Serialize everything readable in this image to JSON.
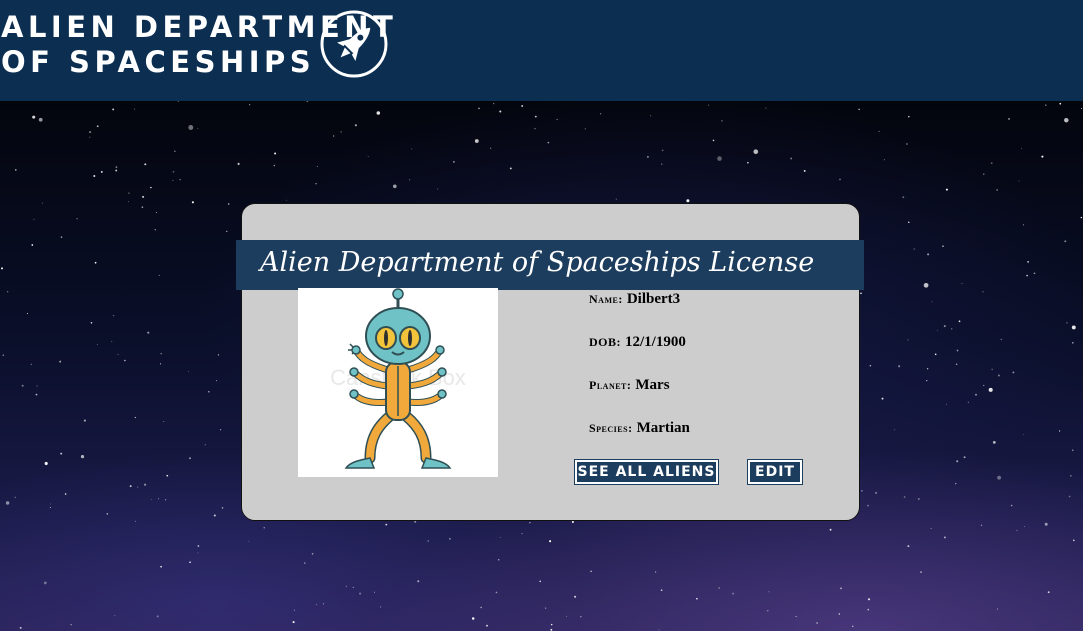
{
  "header": {
    "title_line1": "ALIEN DEPARTMENT",
    "title_line2": "OF SPACESHIPS",
    "logo_icon": "rocket-icon"
  },
  "license": {
    "title": "Alien Department of Spaceships License",
    "photo": "alien-illustration",
    "watermark": "Canstock Box",
    "fields": [
      {
        "label": "Name:",
        "value": "Dilbert3"
      },
      {
        "label": "DOB:",
        "value": "12/1/1900"
      },
      {
        "label": "Planet:",
        "value": "Mars"
      },
      {
        "label": "Species:",
        "value": "Martian"
      }
    ],
    "buttons": {
      "see_all": "SEE ALL ALIENS",
      "edit": "EDIT"
    }
  },
  "colors": {
    "header_bg": "#0b2e51",
    "banner_bg": "#1c3d5e",
    "card_bg": "#cdcdcd",
    "alien_skin": "#6fc3c6",
    "alien_suit": "#f2a93b"
  }
}
